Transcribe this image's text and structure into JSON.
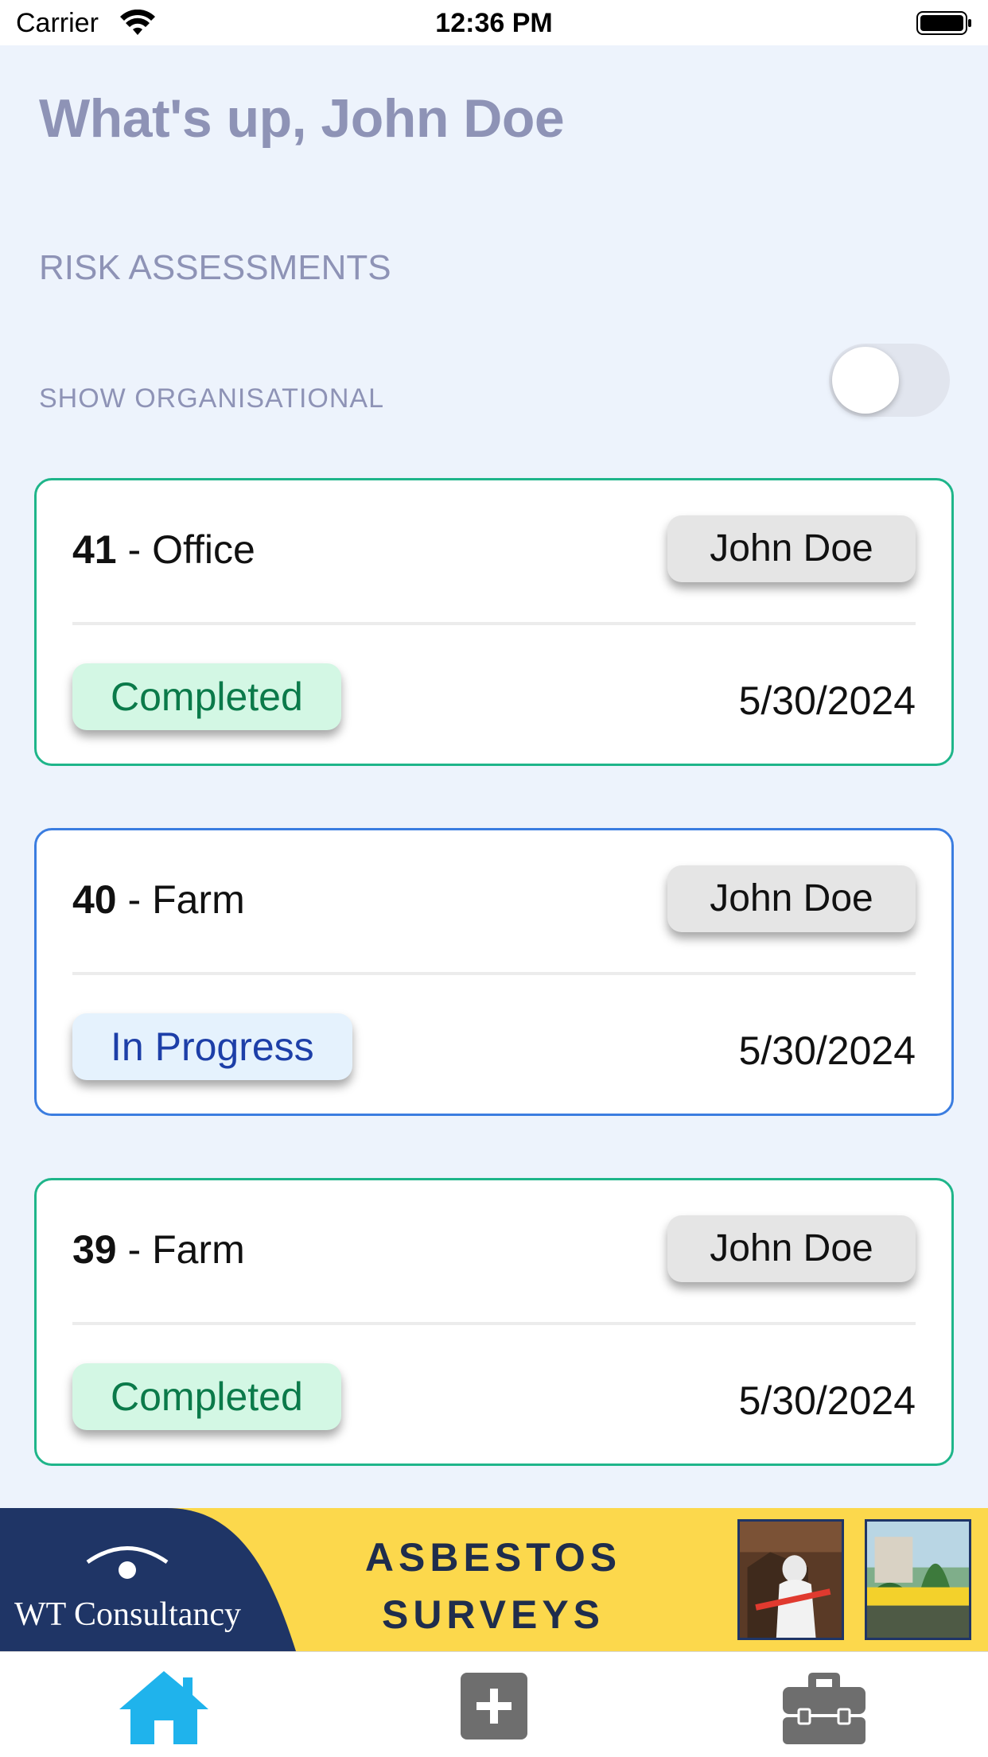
{
  "status_bar": {
    "carrier": "Carrier",
    "time": "12:36 PM"
  },
  "header": {
    "greeting": "What's up, John Doe"
  },
  "section": {
    "title": "RISK ASSESSMENTS",
    "toggle_label": "SHOW ORGANISATIONAL",
    "toggle_on": false
  },
  "assessments": [
    {
      "number": "41",
      "separator": " - ",
      "name": "Office",
      "owner": "John Doe",
      "status": "Completed",
      "date": "5/30/2024"
    },
    {
      "number": "40",
      "separator": " - ",
      "name": "Farm",
      "owner": "John Doe",
      "status": "In Progress",
      "date": "5/30/2024"
    },
    {
      "number": "39",
      "separator": " - ",
      "name": "Farm",
      "owner": "John Doe",
      "status": "Completed",
      "date": "5/30/2024"
    }
  ],
  "banner": {
    "brand": "WT Consultancy",
    "headline_line1": "ASBESTOS",
    "headline_line2": "SURVEYS"
  },
  "tab_bar": {
    "tabs": [
      {
        "icon": "home-icon",
        "active": true
      },
      {
        "icon": "add-icon",
        "active": false
      },
      {
        "icon": "toolbox-icon",
        "active": false
      }
    ]
  },
  "colors": {
    "background": "#edf3fc",
    "muted_text": "#8e93b6",
    "completed_border": "#1fb58a",
    "in_progress_border": "#3b7de0",
    "completed_chip": "#d3f7e4",
    "in_progress_chip": "#e5f2fd",
    "active_tab": "#1fb3ec",
    "inactive_tab": "#6e6e6e",
    "banner_yellow": "#fcd84c",
    "banner_navy": "#1f3566"
  }
}
